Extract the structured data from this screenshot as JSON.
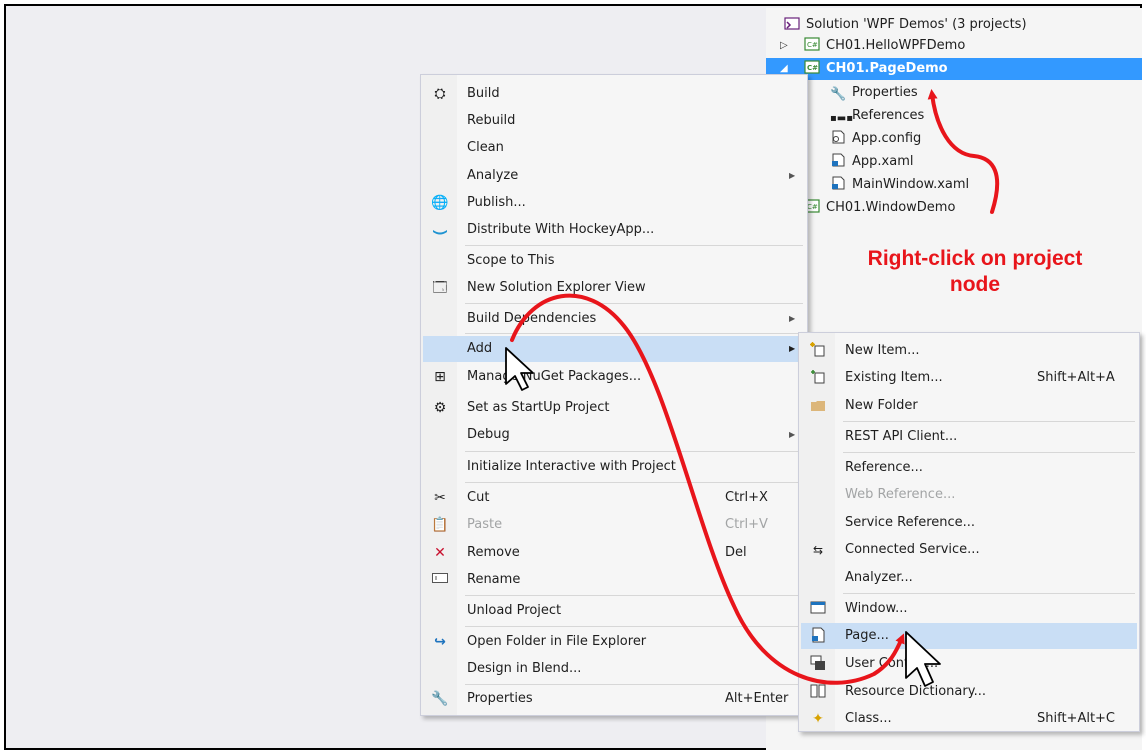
{
  "solution_explorer": {
    "solution_label": "Solution 'WPF Demos' (3 projects)",
    "items": [
      {
        "label": "CH01.HelloWPFDemo",
        "icon": "csharp-project-icon"
      },
      {
        "label": "CH01.PageDemo",
        "icon": "csharp-project-icon",
        "selected": true
      },
      {
        "label": "Properties",
        "icon": "wrench-icon"
      },
      {
        "label": "References",
        "icon": "references-icon"
      },
      {
        "label": "App.config",
        "icon": "config-file-icon"
      },
      {
        "label": "App.xaml",
        "icon": "xaml-file-icon"
      },
      {
        "label": "MainWindow.xaml",
        "icon": "xaml-file-icon"
      },
      {
        "label": "CH01.WindowDemo",
        "icon": "csharp-project-icon"
      }
    ]
  },
  "context_menu": {
    "items": [
      {
        "label": "Build",
        "icon": "build-icon"
      },
      {
        "label": "Rebuild"
      },
      {
        "label": "Clean"
      },
      {
        "label": "Analyze",
        "submenu": true
      },
      {
        "label": "Publish...",
        "icon": "globe-icon"
      },
      {
        "label": "Distribute With HockeyApp...",
        "icon": "hockeyapp-icon"
      },
      {
        "label": "Scope to This"
      },
      {
        "label": "New Solution Explorer View",
        "icon": "new-view-icon"
      },
      {
        "label": "Build Dependencies",
        "submenu": true
      },
      {
        "label": "Add",
        "submenu": true,
        "highlighted": true
      },
      {
        "label": "Manage NuGet Packages...",
        "icon": "nuget-icon"
      },
      {
        "label": "Set as StartUp Project",
        "icon": "gear-icon"
      },
      {
        "label": "Debug",
        "submenu": true
      },
      {
        "label": "Initialize Interactive with Project"
      },
      {
        "label": "Cut",
        "shortcut": "Ctrl+X",
        "icon": "scissors-icon"
      },
      {
        "label": "Paste",
        "shortcut": "Ctrl+V",
        "icon": "paste-icon",
        "disabled": true
      },
      {
        "label": "Remove",
        "shortcut": "Del",
        "icon": "remove-icon"
      },
      {
        "label": "Rename",
        "icon": "rename-icon"
      },
      {
        "label": "Unload Project"
      },
      {
        "label": "Open Folder in File Explorer",
        "icon": "refresh-arrow-icon"
      },
      {
        "label": "Design in Blend..."
      },
      {
        "label": "Properties",
        "shortcut": "Alt+Enter",
        "icon": "wrench-icon"
      }
    ]
  },
  "add_submenu": {
    "items": [
      {
        "label": "New Item...",
        "icon": "new-item-icon"
      },
      {
        "label": "Existing Item...",
        "shortcut": "Shift+Alt+A",
        "icon": "existing-item-icon"
      },
      {
        "label": "New Folder",
        "icon": "folder-icon"
      },
      {
        "label": "REST API Client..."
      },
      {
        "label": "Reference..."
      },
      {
        "label": "Web Reference...",
        "disabled": true
      },
      {
        "label": "Service Reference..."
      },
      {
        "label": "Connected Service...",
        "icon": "connected-service-icon"
      },
      {
        "label": "Analyzer..."
      },
      {
        "label": "Window...",
        "icon": "window-icon"
      },
      {
        "label": "Page...",
        "icon": "page-icon",
        "highlighted": true
      },
      {
        "label": "User Control...",
        "icon": "user-control-icon"
      },
      {
        "label": "Resource Dictionary...",
        "icon": "resource-dictionary-icon"
      },
      {
        "label": "Class...",
        "shortcut": "Shift+Alt+C",
        "icon": "class-icon"
      }
    ]
  },
  "annotation": {
    "line1": "Right-click on project",
    "line2": "node",
    "color": "#e8151b"
  },
  "colors": {
    "selection": "#3399ff",
    "menu_hover": "#c9def5"
  }
}
